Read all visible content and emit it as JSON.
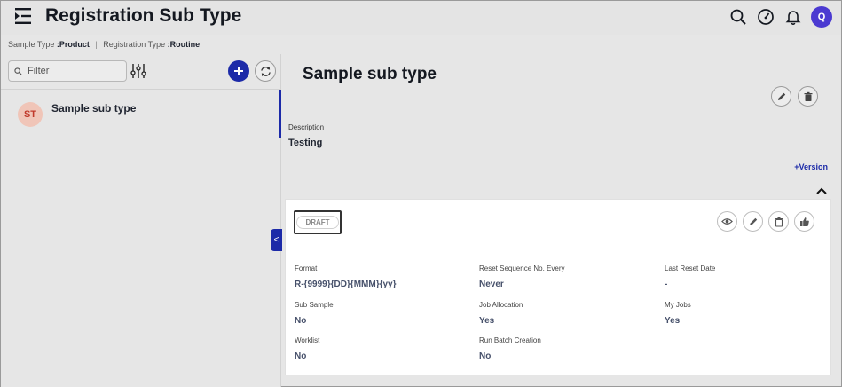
{
  "header": {
    "title": "Registration Sub Type",
    "avatar_initial": "Q",
    "icons": [
      "menu-icon",
      "search-icon",
      "speedometer-icon",
      "bell-icon"
    ]
  },
  "breadcrumb": {
    "sample_type_label": "Sample Type",
    "sample_type_value": ":Product",
    "separator": "|",
    "registration_type_label": "Registration Type",
    "registration_type_value": ":Routine"
  },
  "sidebar": {
    "filter_placeholder": "Filter",
    "items": [
      {
        "initials": "ST",
        "label": "Sample sub type",
        "selected": true
      }
    ],
    "collapse_glyph": "<"
  },
  "detail": {
    "title": "Sample sub type",
    "description_label": "Description",
    "description_value": "Testing",
    "version_link": "+Version"
  },
  "version_card": {
    "status": "DRAFT",
    "fields": [
      {
        "label": "Format",
        "value": "R-{9999}{DD}{MMM}{yy}"
      },
      {
        "label": "Reset Sequence No. Every",
        "value": "Never"
      },
      {
        "label": "Last Reset Date",
        "value": "-"
      },
      {
        "label": "Sub Sample",
        "value": "No"
      },
      {
        "label": "Job Allocation",
        "value": "Yes"
      },
      {
        "label": "My Jobs",
        "value": "Yes"
      },
      {
        "label": "Worklist",
        "value": "No"
      },
      {
        "label": "Run Batch Creation",
        "value": "No"
      }
    ]
  },
  "colors": {
    "accent": "#1c2aa8",
    "avatar": "#4b3ad1",
    "background": "#e6e6e6",
    "card": "#ffffff"
  }
}
